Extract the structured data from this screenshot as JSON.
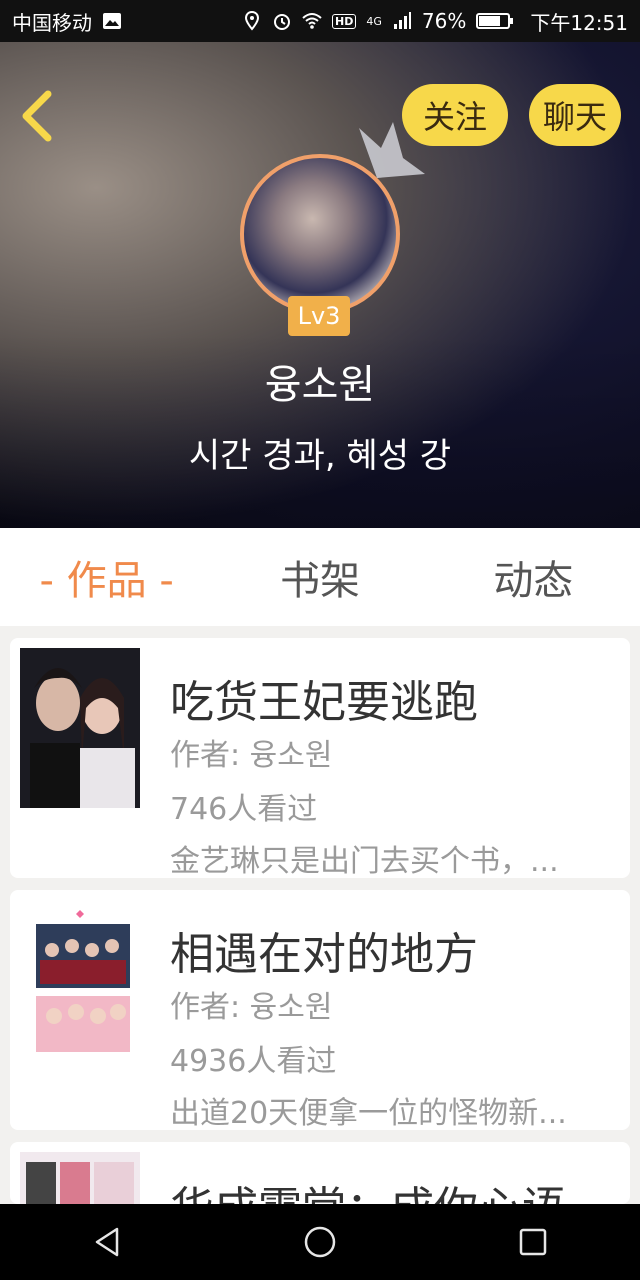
{
  "status_bar": {
    "carrier": "中国移动",
    "network": "4G",
    "battery": "76%",
    "battery_level": 0.76,
    "hd": "HD",
    "time": "下午12:51"
  },
  "profile": {
    "follow_label": "关注",
    "chat_label": "聊天",
    "level": "Lv3",
    "name": "융소원",
    "signature": "시간 경과, 혜성 강"
  },
  "tabs": [
    {
      "label": "- 作品 -",
      "active": true
    },
    {
      "label": "书架",
      "active": false
    },
    {
      "label": "动态",
      "active": false
    }
  ],
  "works": [
    {
      "title": "吃货王妃要逃跑",
      "author": "作者: 융소원",
      "views": "746人看过",
      "desc": "金艺琳只是出门去买个书，..."
    },
    {
      "title": "相遇在对的地方",
      "author": "作者: 융소원",
      "views": "4936人看过",
      "desc": "出道20天便拿一位的怪物新..."
    },
    {
      "title": "华成霜堂：成你心语",
      "author": "",
      "views": "",
      "desc": ""
    }
  ],
  "colors": {
    "accent": "#f08a4b",
    "pill": "#f7d84a",
    "level_badge": "#f1b04a"
  },
  "icons": {
    "back": "back-chevron-icon",
    "crown": "crown-icon",
    "nav": [
      "back-triangle-icon",
      "home-circle-icon",
      "recents-square-icon"
    ]
  }
}
